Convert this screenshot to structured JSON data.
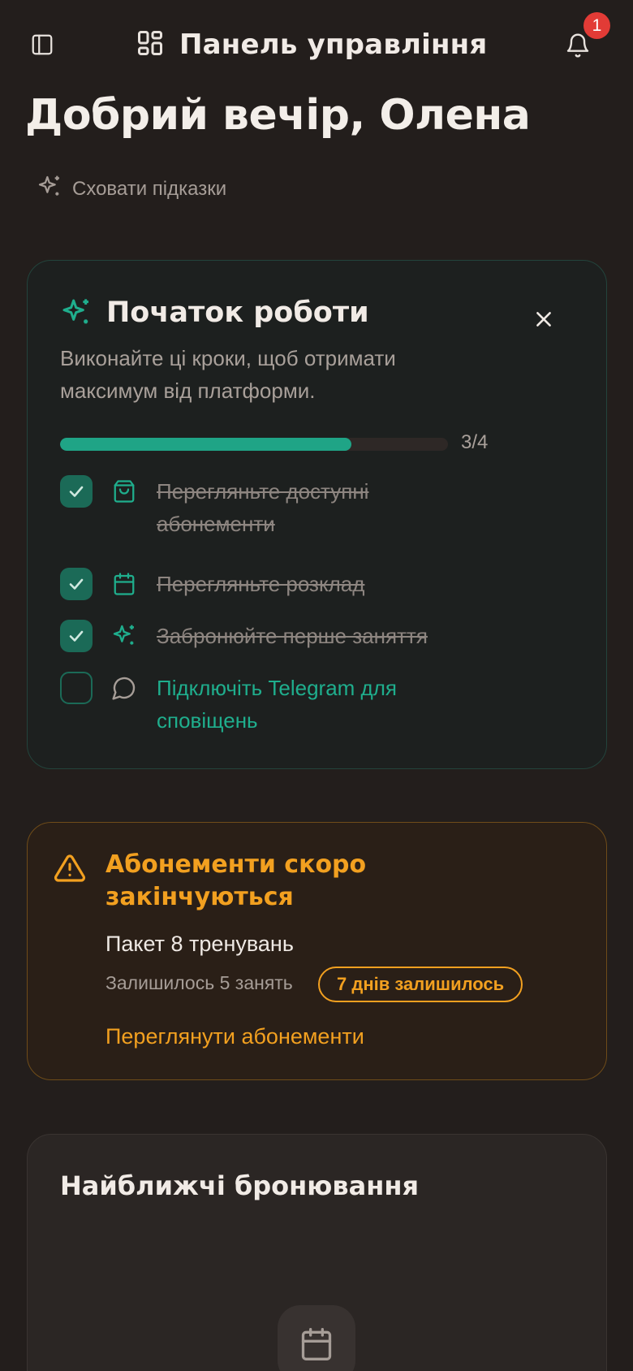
{
  "header": {
    "title": "Панель управління",
    "notification_count": "1"
  },
  "greeting": "Добрий вечір, Олена",
  "hints_toggle": "Сховати підказки",
  "getting_started": {
    "title": "Початок роботи",
    "description": "Виконайте ці кроки, щоб отримати максимум від платформи.",
    "progress_text": "3/4",
    "progress_fraction": 0.75,
    "tasks": [
      {
        "label": "Перегляньте доступні абонементи",
        "done": true,
        "icon": "shopping-bag-icon"
      },
      {
        "label": "Перегляньте розклад",
        "done": true,
        "icon": "calendar-icon"
      },
      {
        "label": "Забронюйте перше заняття",
        "done": true,
        "icon": "sparkles-icon"
      },
      {
        "label": "Підключіть Telegram для сповіщень",
        "done": false,
        "icon": "message-circle-icon"
      }
    ]
  },
  "expiring": {
    "title": "Абонементи скоро закінчуються",
    "package_name": "Пакет 8 тренувань",
    "sessions_left": "Залишилось 5 занять",
    "days_left": "7 днів залишилось",
    "link_label": "Переглянути абонементи"
  },
  "upcoming": {
    "title": "Найближчі бронювання"
  },
  "colors": {
    "background": "#231e1c",
    "accent_green": "#1fa486",
    "warning_orange": "#f2a020",
    "badge_red": "#e23b36"
  }
}
